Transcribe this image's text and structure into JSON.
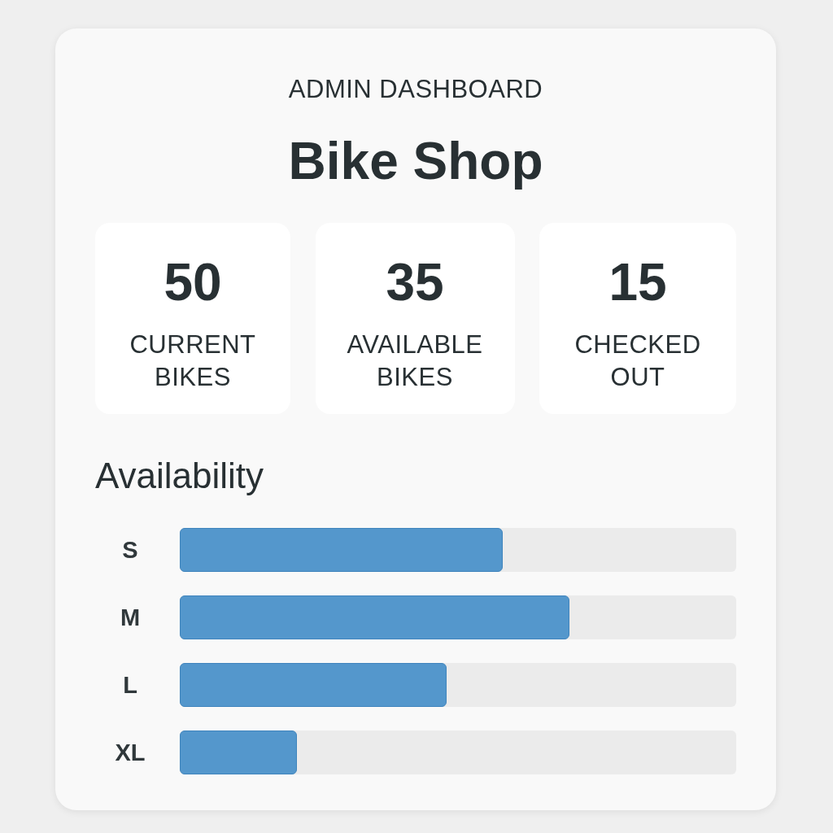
{
  "header": {
    "eyebrow": "ADMIN DASHBOARD",
    "title": "Bike Shop"
  },
  "stats": [
    {
      "value": "50",
      "label": "CURRENT BIKES"
    },
    {
      "value": "35",
      "label": "AVAILABLE BIKES"
    },
    {
      "value": "15",
      "label": "CHECKED OUT"
    }
  ],
  "availability": {
    "title": "Availability",
    "rows": [
      {
        "size": "S",
        "level": 0.58
      },
      {
        "size": "M",
        "level": 0.7
      },
      {
        "size": "L",
        "level": 0.48
      },
      {
        "size": "XL",
        "level": 0.21
      }
    ]
  }
}
